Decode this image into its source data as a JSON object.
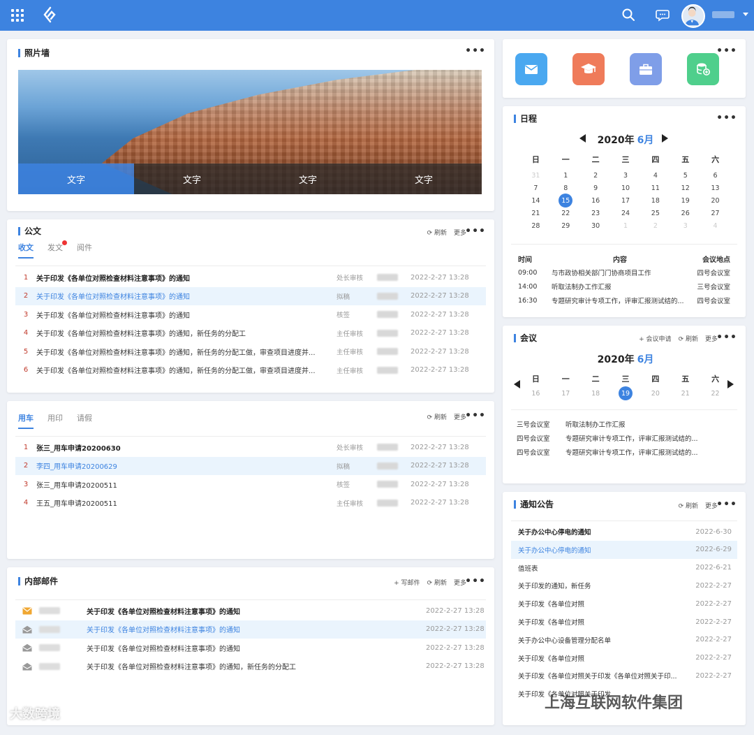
{
  "photo_wall": {
    "title": "照片墙",
    "captions": [
      "文字",
      "文字",
      "文字",
      "文字"
    ]
  },
  "official_docs": {
    "title": "公文",
    "tabs": [
      "收文",
      "发文",
      "阅件"
    ],
    "refresh": "刷新",
    "more": "更多",
    "rows": [
      {
        "idx": "1",
        "title": "关于印发《各单位对照检查材料注意事项》的通知",
        "status": "处长审核",
        "date": "2022-2-27  13:28"
      },
      {
        "idx": "2",
        "title": "关于印发《各单位对照检查材料注意事项》的通知",
        "status": "拟稿",
        "date": "2022-2-27  13:28"
      },
      {
        "idx": "3",
        "title": "关于印发《各单位对照检查材料注意事项》的通知",
        "status": "核签",
        "date": "2022-2-27  13:28"
      },
      {
        "idx": "4",
        "title": "关于印发《各单位对照检查材料注意事项》的通知，新任务的分配工",
        "status": "主任审核",
        "date": "2022-2-27  13:28"
      },
      {
        "idx": "5",
        "title": "关于印发《各单位对照检查材料注意事项》的通知，新任务的分配工做，审查项目进度并...",
        "status": "主任审核",
        "date": "2022-2-27  13:28"
      },
      {
        "idx": "6",
        "title": "关于印发《各单位对照检查材料注意事项》的通知，新任务的分配工做，审查项目进度并...",
        "status": "主任审核",
        "date": "2022-2-27  13:28"
      }
    ]
  },
  "vehicle": {
    "tabs": [
      "用车",
      "用印",
      "请假"
    ],
    "refresh": "刷新",
    "more": "更多",
    "rows": [
      {
        "idx": "1",
        "title": "张三_用车申请20200630",
        "status": "处长审核",
        "date": "2022-2-27  13:28"
      },
      {
        "idx": "2",
        "title": "李四_用车申请20200629",
        "status": "拟稿",
        "date": "2022-2-27  13:28"
      },
      {
        "idx": "3",
        "title": "张三_用车申请20200511",
        "status": "核签",
        "date": "2022-2-27  13:28"
      },
      {
        "idx": "4",
        "title": "王五_用车申请20200511",
        "status": "主任审核",
        "date": "2022-2-27  13:28"
      }
    ]
  },
  "internal_mail": {
    "title": "内部邮件",
    "write": "写邮件",
    "refresh": "刷新",
    "more": "更多",
    "rows": [
      {
        "title": "关于印发《各单位对照检查材料注意事项》的通知",
        "date": "2022-2-27  13:28"
      },
      {
        "title": "关于印发《各单位对照检查材料注意事项》的通知",
        "date": "2022-2-27  13:28"
      },
      {
        "title": "关于印发《各单位对照检查材料注意事项》的通知",
        "date": "2022-2-27  13:28"
      },
      {
        "title": "关于印发《各单位对照检查材料注意事项》的通知，新任务的分配工",
        "date": "2022-2-27  13:28"
      }
    ]
  },
  "quick_apps": [
    {
      "icon": "mail-icon",
      "color": "#4aa8f0"
    },
    {
      "icon": "graduation-cap-icon",
      "color": "#ef7b5a"
    },
    {
      "icon": "briefcase-icon",
      "color": "#7f9ee8"
    },
    {
      "icon": "database-icon",
      "color": "#4fcf8c"
    }
  ],
  "schedule": {
    "title": "日程",
    "year": "2020年",
    "month": "6月",
    "weekdays": [
      "日",
      "一",
      "二",
      "三",
      "四",
      "五",
      "六"
    ],
    "days": [
      {
        "d": "31",
        "dim": true
      },
      {
        "d": "1"
      },
      {
        "d": "2"
      },
      {
        "d": "3"
      },
      {
        "d": "4"
      },
      {
        "d": "5"
      },
      {
        "d": "6"
      },
      {
        "d": "7"
      },
      {
        "d": "8"
      },
      {
        "d": "9"
      },
      {
        "d": "10"
      },
      {
        "d": "11"
      },
      {
        "d": "12"
      },
      {
        "d": "13"
      },
      {
        "d": "14"
      },
      {
        "d": "15",
        "today": true
      },
      {
        "d": "16"
      },
      {
        "d": "17"
      },
      {
        "d": "18"
      },
      {
        "d": "19"
      },
      {
        "d": "20"
      },
      {
        "d": "21"
      },
      {
        "d": "22"
      },
      {
        "d": "23"
      },
      {
        "d": "24"
      },
      {
        "d": "25"
      },
      {
        "d": "26"
      },
      {
        "d": "27"
      },
      {
        "d": "28"
      },
      {
        "d": "29"
      },
      {
        "d": "30"
      },
      {
        "d": "1",
        "dim": true
      },
      {
        "d": "2",
        "dim": true
      },
      {
        "d": "3",
        "dim": true
      },
      {
        "d": "4",
        "dim": true
      }
    ],
    "table_headers": {
      "time": "时间",
      "content": "内容",
      "place": "会议地点"
    },
    "rows": [
      {
        "time": "09:00",
        "content": "与市政协相关部门门协商项目工作",
        "place": "四号会议室"
      },
      {
        "time": "14:00",
        "content": "听取法制办工作汇报",
        "place": "三号会议室"
      },
      {
        "time": "16:30",
        "content": "专题研究审计专项工作，评审汇报测试结的...",
        "place": "四号会议室"
      }
    ]
  },
  "meeting": {
    "title": "会议",
    "apply": "会议申请",
    "refresh": "刷新",
    "more": "更多",
    "year": "2020年",
    "month": "6月",
    "weekdays": [
      "日",
      "一",
      "二",
      "三",
      "四",
      "五",
      "六"
    ],
    "days": [
      "16",
      "17",
      "18",
      "19",
      "20",
      "21",
      "22"
    ],
    "today": "19",
    "rows": [
      {
        "room": "三号会议室",
        "topic": "听取法制办工作汇报"
      },
      {
        "room": "四号会议室",
        "topic": "专题研究审计专项工作，评审汇报测试结的..."
      },
      {
        "room": "四号会议室",
        "topic": "专题研究审计专项工作，评审汇报测试结的..."
      }
    ]
  },
  "notices": {
    "title": "通知公告",
    "refresh": "刷新",
    "more": "更多",
    "rows": [
      {
        "title": "关于办公中心停电的通知",
        "date": "2022-6-30"
      },
      {
        "title": "关于办公中心停电的通知",
        "date": "2022-6-29"
      },
      {
        "title": "值班表",
        "date": "2022-6-21"
      },
      {
        "title": "关于印发的通知，新任务",
        "date": "2022-2-27"
      },
      {
        "title": "关于印发《各单位对照",
        "date": "2022-2-27"
      },
      {
        "title": "关于印发《各单位对照",
        "date": "2022-2-27"
      },
      {
        "title": "关于办公中心设备管理分配名单",
        "date": "2022-2-27"
      },
      {
        "title": "关于印发《各单位对照",
        "date": "2022-2-27"
      },
      {
        "title": "关于印发《各单位对照关于印发《各单位对照关于印...",
        "date": "2022-2-27"
      },
      {
        "title": "关于印发《各单位对照关于印发",
        "date": ""
      }
    ]
  },
  "watermarks": {
    "left": "大数跨境",
    "right": "上海互联网软件集团"
  }
}
